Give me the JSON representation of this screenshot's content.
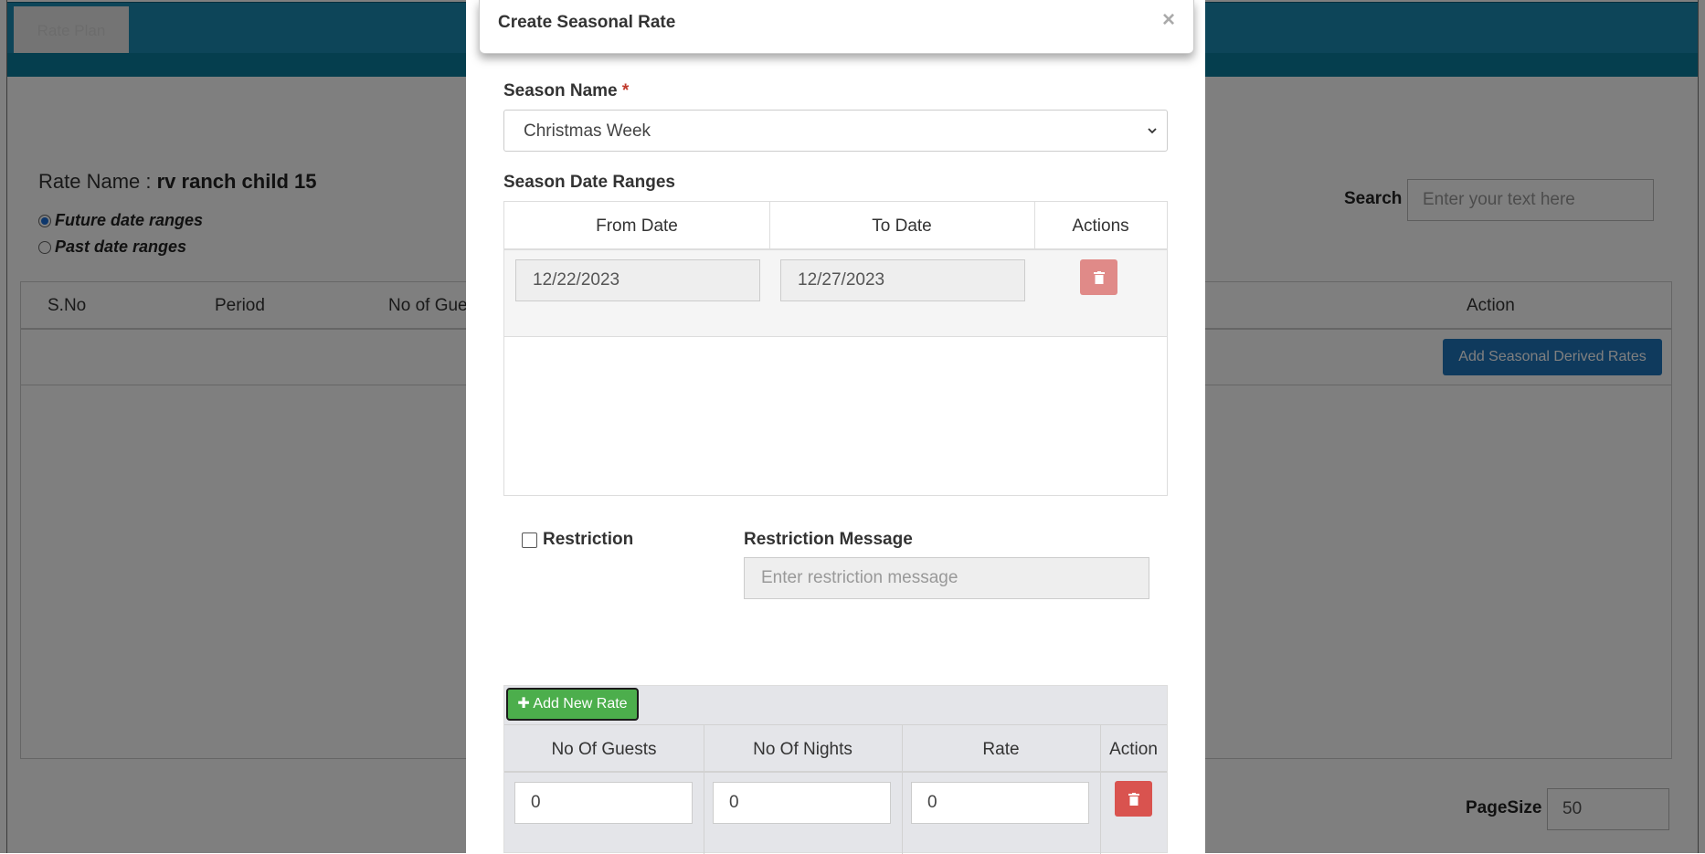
{
  "background": {
    "tab_label": "Rate Plan",
    "rate_name_label": "Rate Name : ",
    "rate_name_value": "rv ranch child 15",
    "radio_future": "Future date ranges",
    "radio_past": "Past date ranges",
    "search_label": "Search",
    "search_placeholder": "Enter your text here",
    "table_headers": [
      "S.No",
      "Period",
      "No of Gue",
      "Action"
    ],
    "add_derived_button": "Add Seasonal Derived Rates",
    "pagesize_label": "PageSize",
    "pagesize_value": "50"
  },
  "modal": {
    "title": "Create Seasonal Rate",
    "close_symbol": "×",
    "season_name_label": "Season Name",
    "required_mark": "*",
    "season_name_value": "Christmas Week",
    "date_ranges_label": "Season Date Ranges",
    "date_ranges_headers": [
      "From Date",
      "To Date",
      "Actions"
    ],
    "date_ranges": [
      {
        "from": "12/22/2023",
        "to": "12/27/2023"
      }
    ],
    "restriction_label": "Restriction",
    "restriction_message_label": "Restriction Message",
    "restriction_message_placeholder": "Enter restriction message",
    "add_rate_button": "Add New Rate",
    "rates_headers": [
      "No Of Guests",
      "No Of Nights",
      "Rate",
      "Action"
    ],
    "rates": [
      {
        "guests": "0",
        "nights": "0",
        "rate": "0"
      }
    ]
  },
  "colors": {
    "header_teal": "#1a8bb3",
    "primary_blue": "#1f74bb",
    "success_green": "#4cae4c",
    "danger_red": "#d9534f"
  }
}
